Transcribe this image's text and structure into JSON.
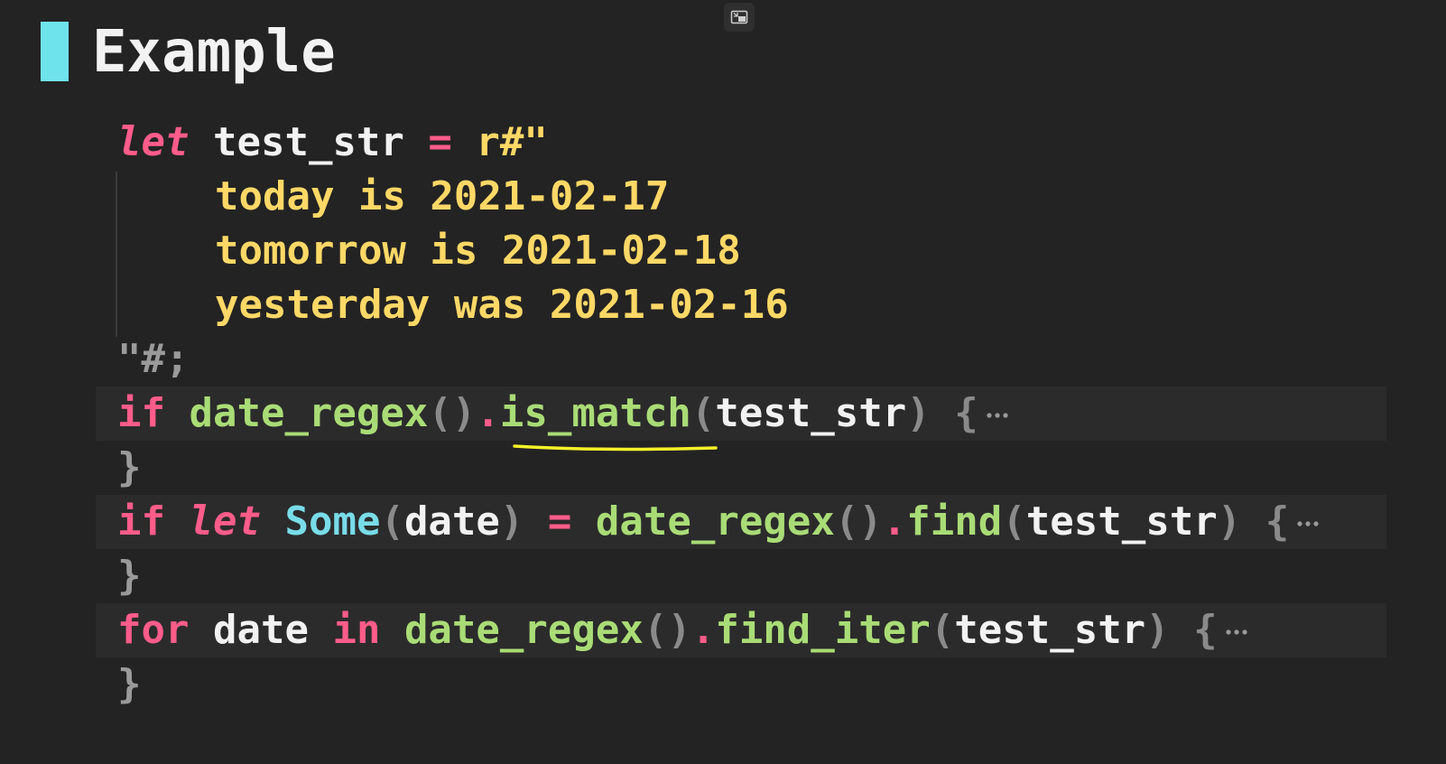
{
  "heading": {
    "title": "Example"
  },
  "code": {
    "line1": {
      "kw_let": "let",
      "ident": "test_str",
      "eq": "=",
      "raw_start": "r#\""
    },
    "line2": {
      "text": "today is 2021-02-17"
    },
    "line3": {
      "text": "tomorrow is 2021-02-18"
    },
    "line4": {
      "text": "yesterday was 2021-02-16"
    },
    "line5": {
      "raw_end": "\"#;"
    },
    "line6": {
      "kw_if": "if",
      "fn_regex": "date_regex",
      "parens": "()",
      "dot": ".",
      "method": "is_match",
      "open": "(",
      "arg": "test_str",
      "close": ")",
      "brace": "{"
    },
    "line7": {
      "brace": "}"
    },
    "line8": {
      "kw_if": "if",
      "kw_let": "let",
      "type": "Some",
      "open1": "(",
      "bind": "date",
      "close1": ")",
      "eq": "=",
      "fn_regex": "date_regex",
      "parens": "()",
      "dot": ".",
      "method": "find",
      "open": "(",
      "arg": "test_str",
      "close": ")",
      "brace": "{"
    },
    "line9": {
      "brace": "}"
    },
    "line10": {
      "kw_for": "for",
      "var": "date",
      "kw_in": "in",
      "fn_regex": "date_regex",
      "parens": "()",
      "dot": ".",
      "method": "find_iter",
      "open": "(",
      "arg": "test_str",
      "close": ")",
      "brace": "{"
    },
    "line11": {
      "brace": "}"
    }
  },
  "colors": {
    "background": "#232323",
    "keyword": "#ff5c8a",
    "string": "#ffd866",
    "function": "#a9dc76",
    "type": "#78dce8",
    "accent_bar": "#6fe3ec",
    "annotation_underline": "#f5f02a"
  },
  "icons": {
    "pip": "exit-picture-in-picture-icon",
    "fold": "ellipsis-fold-icon"
  }
}
